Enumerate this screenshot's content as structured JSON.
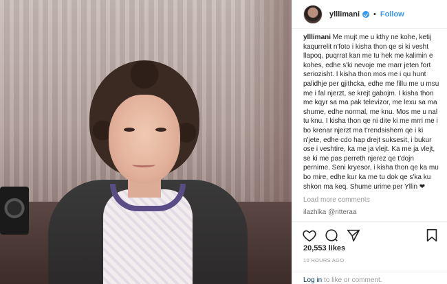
{
  "header": {
    "username": "ylllimani",
    "separator": "•",
    "follow_label": "Follow"
  },
  "caption": {
    "username": "ylllimani",
    "text": "Me mujt me u kthy ne kohe, ketij kaqurrelit n'foto i kisha thon qe si ki vesht llapoq, puqrrat kan me tu hek me kalimin e kohes, edhe s'ki nevoje me marr jeten fort seriozisht. I kisha thon mos me i qu hunt palidhje per gjithcka, edhe me fillu me u msu me i fal njerzt, se krejt gabojm. I kisha thon me kqyr sa ma pak televizor, me lexu sa ma shume, edhe normal, me knu. Mos me u nal tu knu. I kisha thon qe ni dite ki me mrri me i bo krenar njerzt ma t'rendsishem qe i ki n'jete, edhe cdo hap drejt suksesit, i bukur ose i veshtire, ka me ja vlejt. Ka me ja vlejt, se ki me pas perreth njerez qe t'dojn pernime. Seni kryesor, i kisha thon qe ka mu bo mire, edhe kur ka me tu dok qe s'ka ku shkon ma keq. Shume urime per Yllin ❤"
  },
  "load_more_label": "Load more comments",
  "partial_comment": "ilazhlka @ritteraa",
  "likes": "20,553 likes",
  "timestamp": "10 HOURS AGO",
  "login": {
    "link_label": "Log in",
    "suffix": " to like or comment."
  },
  "icons": {
    "like": "heart-icon",
    "comment": "comment-icon",
    "share": "share-icon",
    "save": "bookmark-icon",
    "verified": "verified-badge-icon"
  },
  "colors": {
    "accent": "#3897f0",
    "text": "#262626",
    "muted": "#999999",
    "link": "#003569"
  }
}
